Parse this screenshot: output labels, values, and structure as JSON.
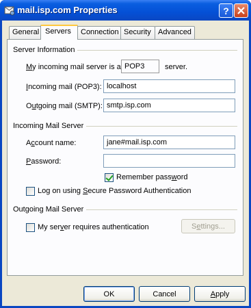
{
  "window": {
    "title": "mail.isp.com Properties"
  },
  "tabs": [
    "General",
    "Servers",
    "Connection",
    "Security",
    "Advanced"
  ],
  "server_info": {
    "group_title": "Server Information",
    "incoming_type_prefix": "y incoming mail server is a",
    "incoming_type_prefix_key": "M",
    "incoming_type_value": "POP3",
    "incoming_type_suffix": "server.",
    "incoming_label_key": "I",
    "incoming_label_rest": "ncoming mail (POP3):",
    "incoming_value": "localhost",
    "outgoing_label_key": "u",
    "outgoing_label_pre": "O",
    "outgoing_label_rest": "tgoing mail (SMTP):",
    "outgoing_value": "smtp.isp.com"
  },
  "incoming_server": {
    "group_title": "Incoming Mail Server",
    "account_label_pre": "A",
    "account_label_key": "c",
    "account_label_rest": "count name:",
    "account_value": "jane#mail.isp.com",
    "password_label_key": "P",
    "password_label_rest": "assword:",
    "password_value": "",
    "remember_label_pre": "Remember pass",
    "remember_label_key": "w",
    "remember_label_rest": "ord",
    "remember_checked": true,
    "spa_label_pre": "Log on using ",
    "spa_label_key": "S",
    "spa_label_rest": "ecure Password Authentication",
    "spa_checked": false
  },
  "outgoing_server": {
    "group_title": "Outgoing Mail Server",
    "auth_label_pre": "My ser",
    "auth_label_key": "v",
    "auth_label_rest": "er requires authentication",
    "auth_checked": false,
    "settings_pre": "S",
    "settings_key": "e",
    "settings_rest": "ttings..."
  },
  "footer": {
    "ok": "OK",
    "cancel": "Cancel",
    "apply_key": "A",
    "apply_rest": "pply"
  }
}
